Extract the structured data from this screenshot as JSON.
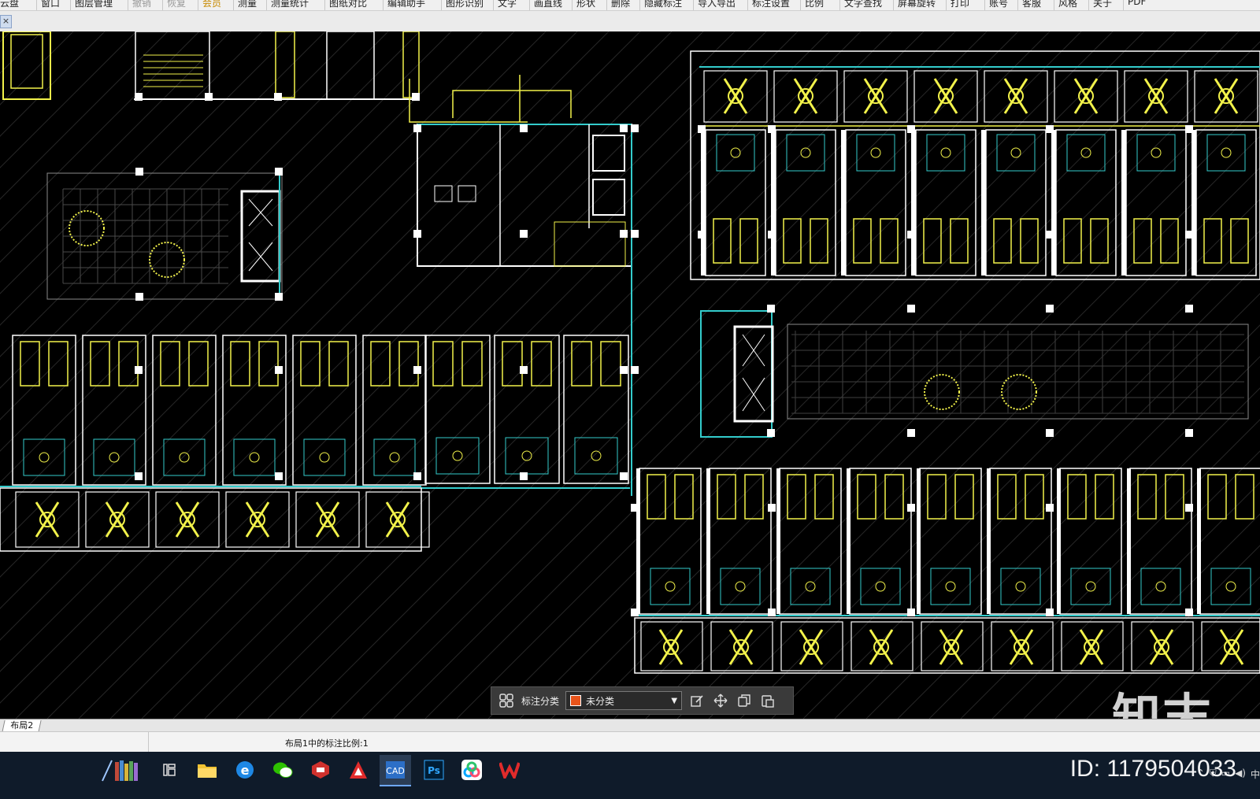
{
  "menubar": {
    "items": [
      {
        "label": "云盘",
        "state": "normal"
      },
      {
        "label": "窗口",
        "state": "normal"
      },
      {
        "label": "图层管理",
        "state": "normal"
      },
      {
        "label": "撤销",
        "state": "dim"
      },
      {
        "label": "恢复",
        "state": "dim"
      },
      {
        "label": "会员",
        "state": "vip"
      },
      {
        "label": "测量",
        "state": "normal"
      },
      {
        "label": "测量统计",
        "state": "normal"
      },
      {
        "label": "图纸对比",
        "state": "normal"
      },
      {
        "label": "编辑助手",
        "state": "normal"
      },
      {
        "label": "图形识别",
        "state": "normal"
      },
      {
        "label": "文字",
        "state": "normal"
      },
      {
        "label": "画直线",
        "state": "normal"
      },
      {
        "label": "形状",
        "state": "normal"
      },
      {
        "label": "删除",
        "state": "normal"
      },
      {
        "label": "隐藏标注",
        "state": "normal"
      },
      {
        "label": "导入导出",
        "state": "normal"
      },
      {
        "label": "标注设置",
        "state": "normal"
      },
      {
        "label": "比例",
        "state": "normal"
      },
      {
        "label": "文字查找",
        "state": "normal"
      },
      {
        "label": "屏幕旋转",
        "state": "normal"
      },
      {
        "label": "打印",
        "state": "normal"
      },
      {
        "label": "账号",
        "state": "normal"
      },
      {
        "label": "客服",
        "state": "normal"
      },
      {
        "label": "风格",
        "state": "normal"
      },
      {
        "label": "关于",
        "state": "normal"
      },
      {
        "label": "PDF",
        "state": "normal"
      }
    ]
  },
  "tab_close_label": "×",
  "annotation_toolbar": {
    "category_label": "标注分类",
    "category_value": "未分类",
    "category_color": "#e8541b",
    "icons": [
      "grid-icon",
      "edit-icon",
      "move-icon",
      "copy-icon",
      "paste-icon"
    ]
  },
  "layout_tab": "布局2",
  "status_text": "布局1中的标注比例:1",
  "watermark": {
    "logo_text": "知末",
    "id_text": "ID: 1179504033"
  },
  "taskbar": {
    "apps": [
      "library-icon",
      "task-view-icon",
      "file-explorer-icon",
      "ie-browser-icon",
      "wechat-icon",
      "sketchup-icon",
      "autocad-icon",
      "cad-viewer-icon",
      "photoshop-icon",
      "baidu-netdisk-icon",
      "wps-icon"
    ],
    "active_app": "cad-viewer-icon"
  },
  "colors": {
    "cad_background": "#000000",
    "cad_yellow": "#f2f24a",
    "cad_white": "#ffffff",
    "cad_cyan": "#33cccc",
    "cad_gray": "#8a8a8a"
  }
}
